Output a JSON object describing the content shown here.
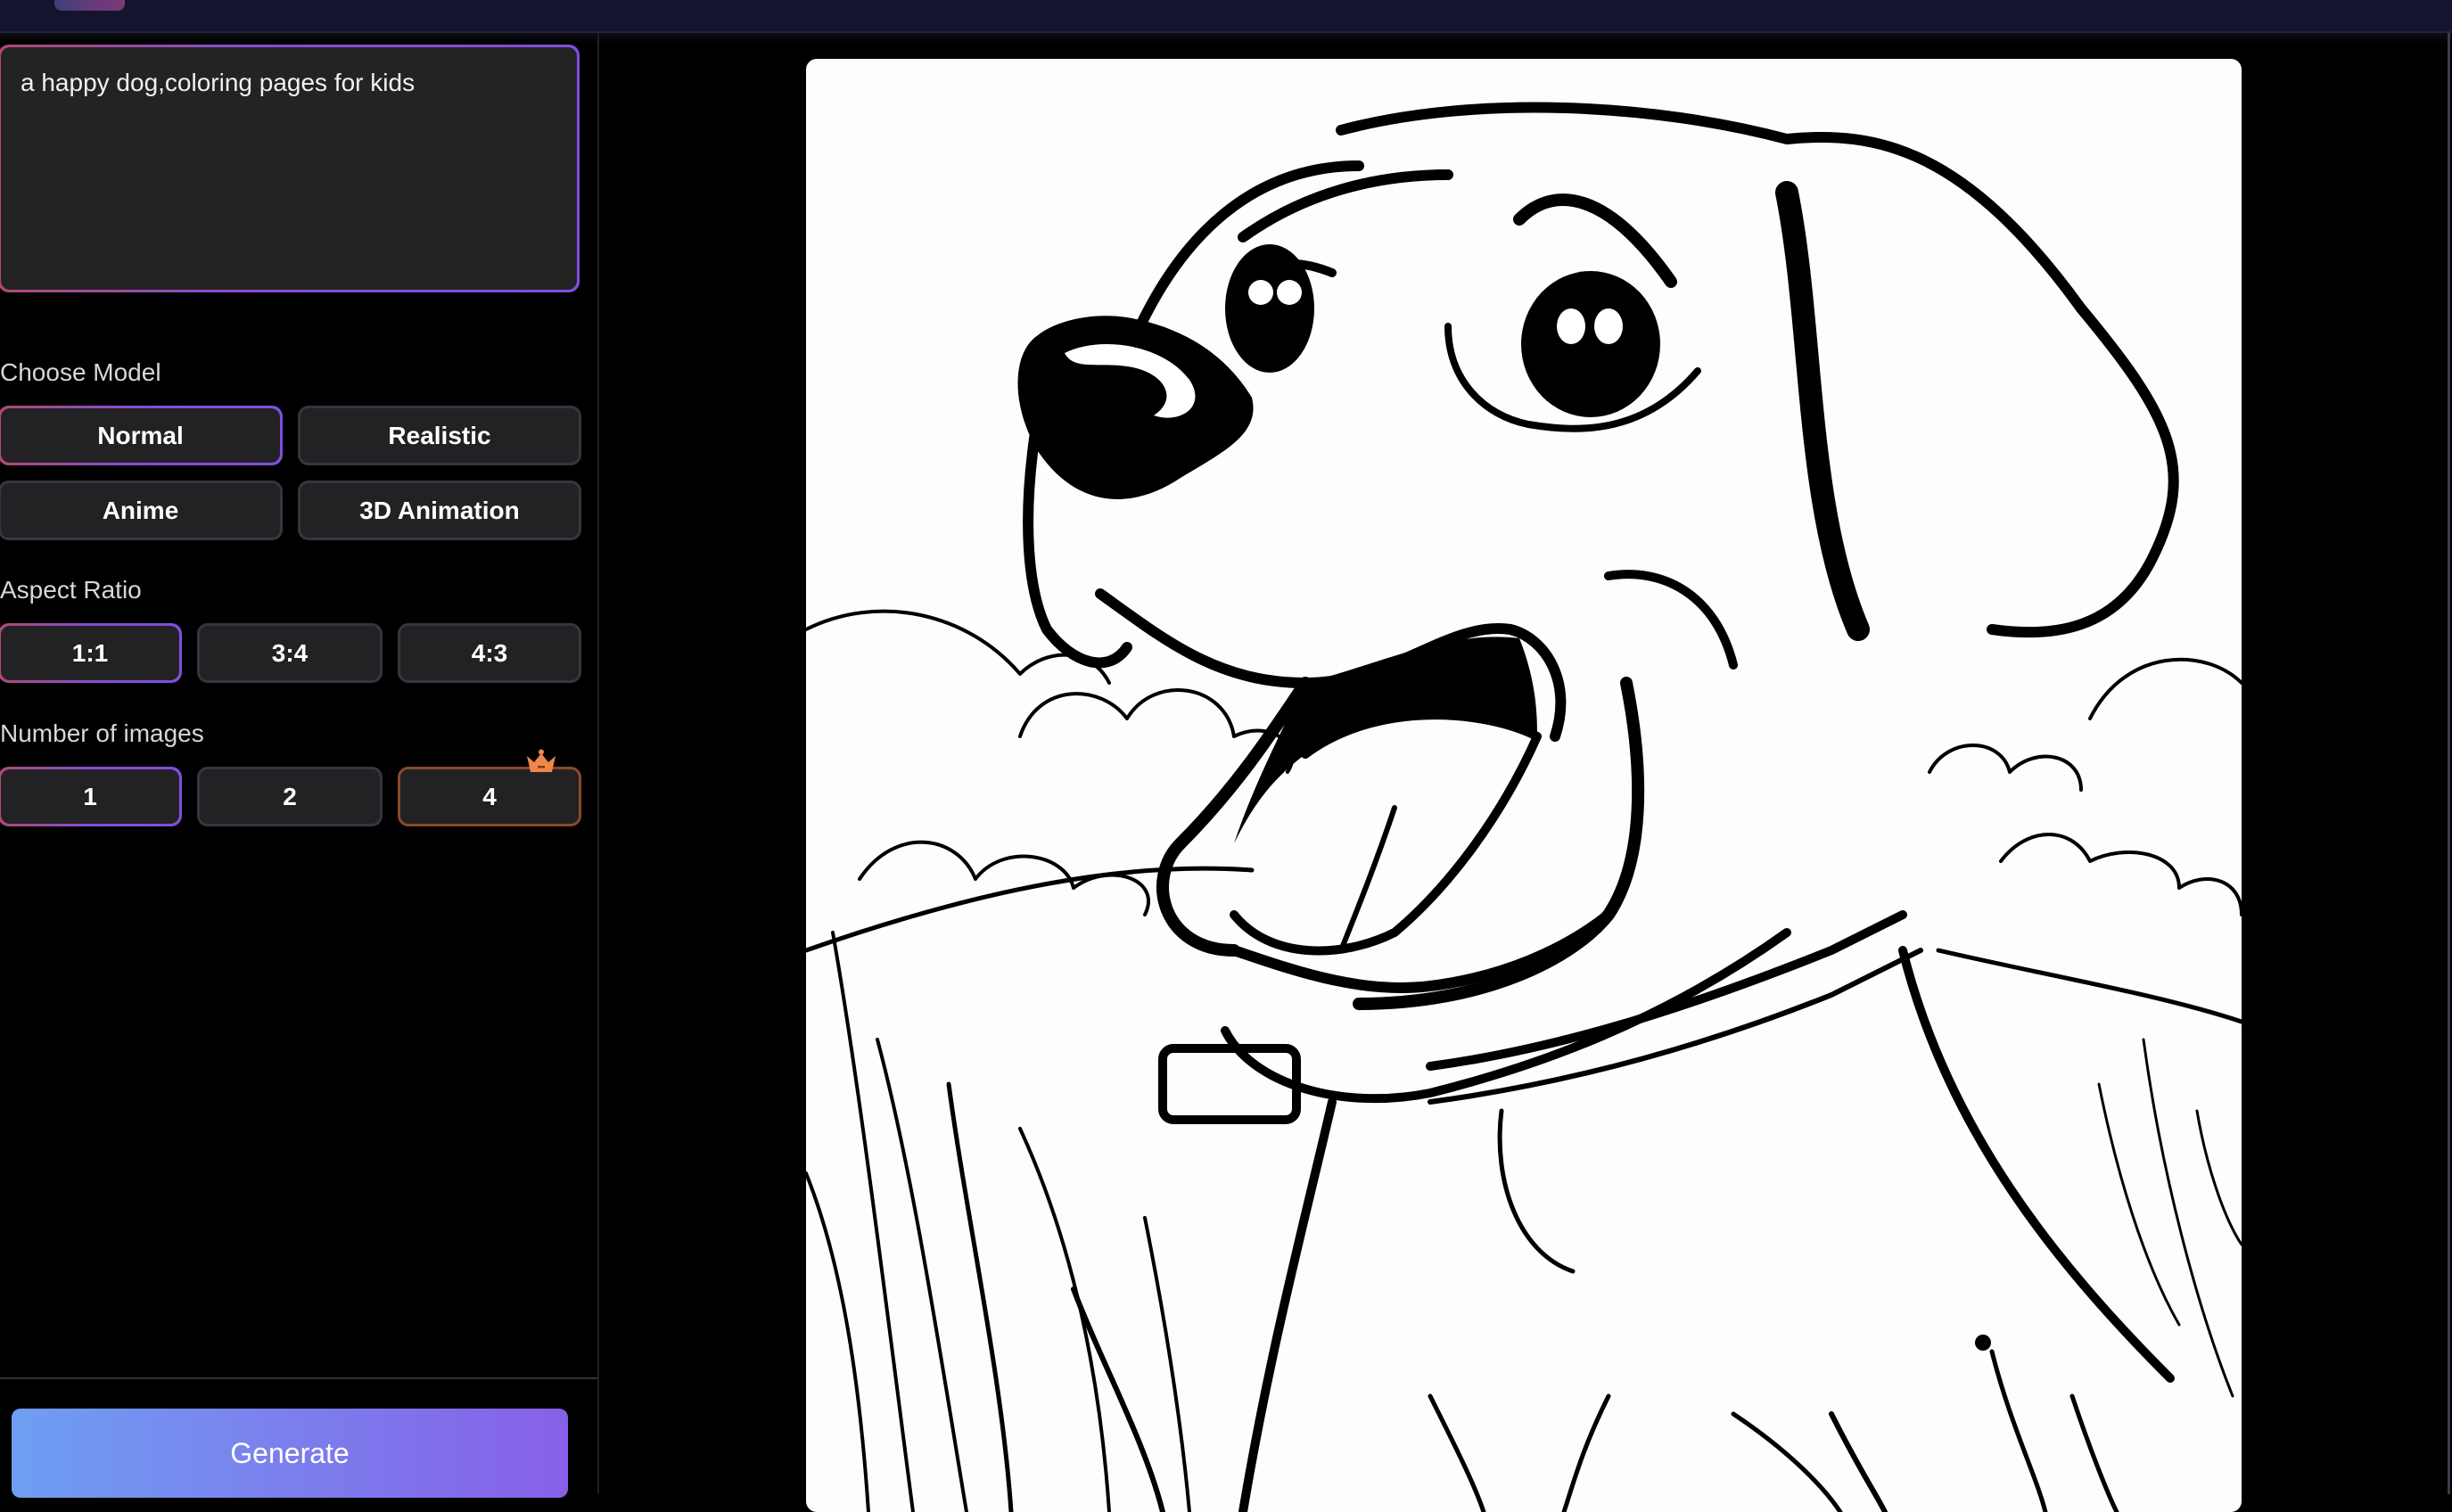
{
  "topbar": {},
  "prompt": {
    "value": "a happy dog,coloring pages for kids",
    "placeholder": ""
  },
  "model": {
    "label": "Choose Model",
    "options": [
      "Normal",
      "Realistic",
      "Anime",
      "3D Animation"
    ],
    "selected": "Normal"
  },
  "aspect_ratio": {
    "label": "Aspect Ratio",
    "options": [
      "1:1",
      "3:4",
      "4:3"
    ],
    "selected": "1:1"
  },
  "num_images": {
    "label": "Number of images",
    "options": [
      "1",
      "2",
      "4"
    ],
    "selected": "1",
    "premium_option": "4",
    "premium_icon": "crown-icon"
  },
  "generate": {
    "label": "Generate"
  },
  "result_image": {
    "description": "Black-and-white line-art coloring page of a happy dog with open mouth and tongue out, wearing a collar, in a grassy field with clouds"
  },
  "colors": {
    "accent_gradient_start": "#b04a72",
    "accent_gradient_end": "#7f4fe0",
    "generate_gradient_start": "#6e9ff2",
    "generate_gradient_end": "#8760e8",
    "premium": "#f0874a",
    "topbar": "#14142e",
    "button_bg": "#222225"
  }
}
